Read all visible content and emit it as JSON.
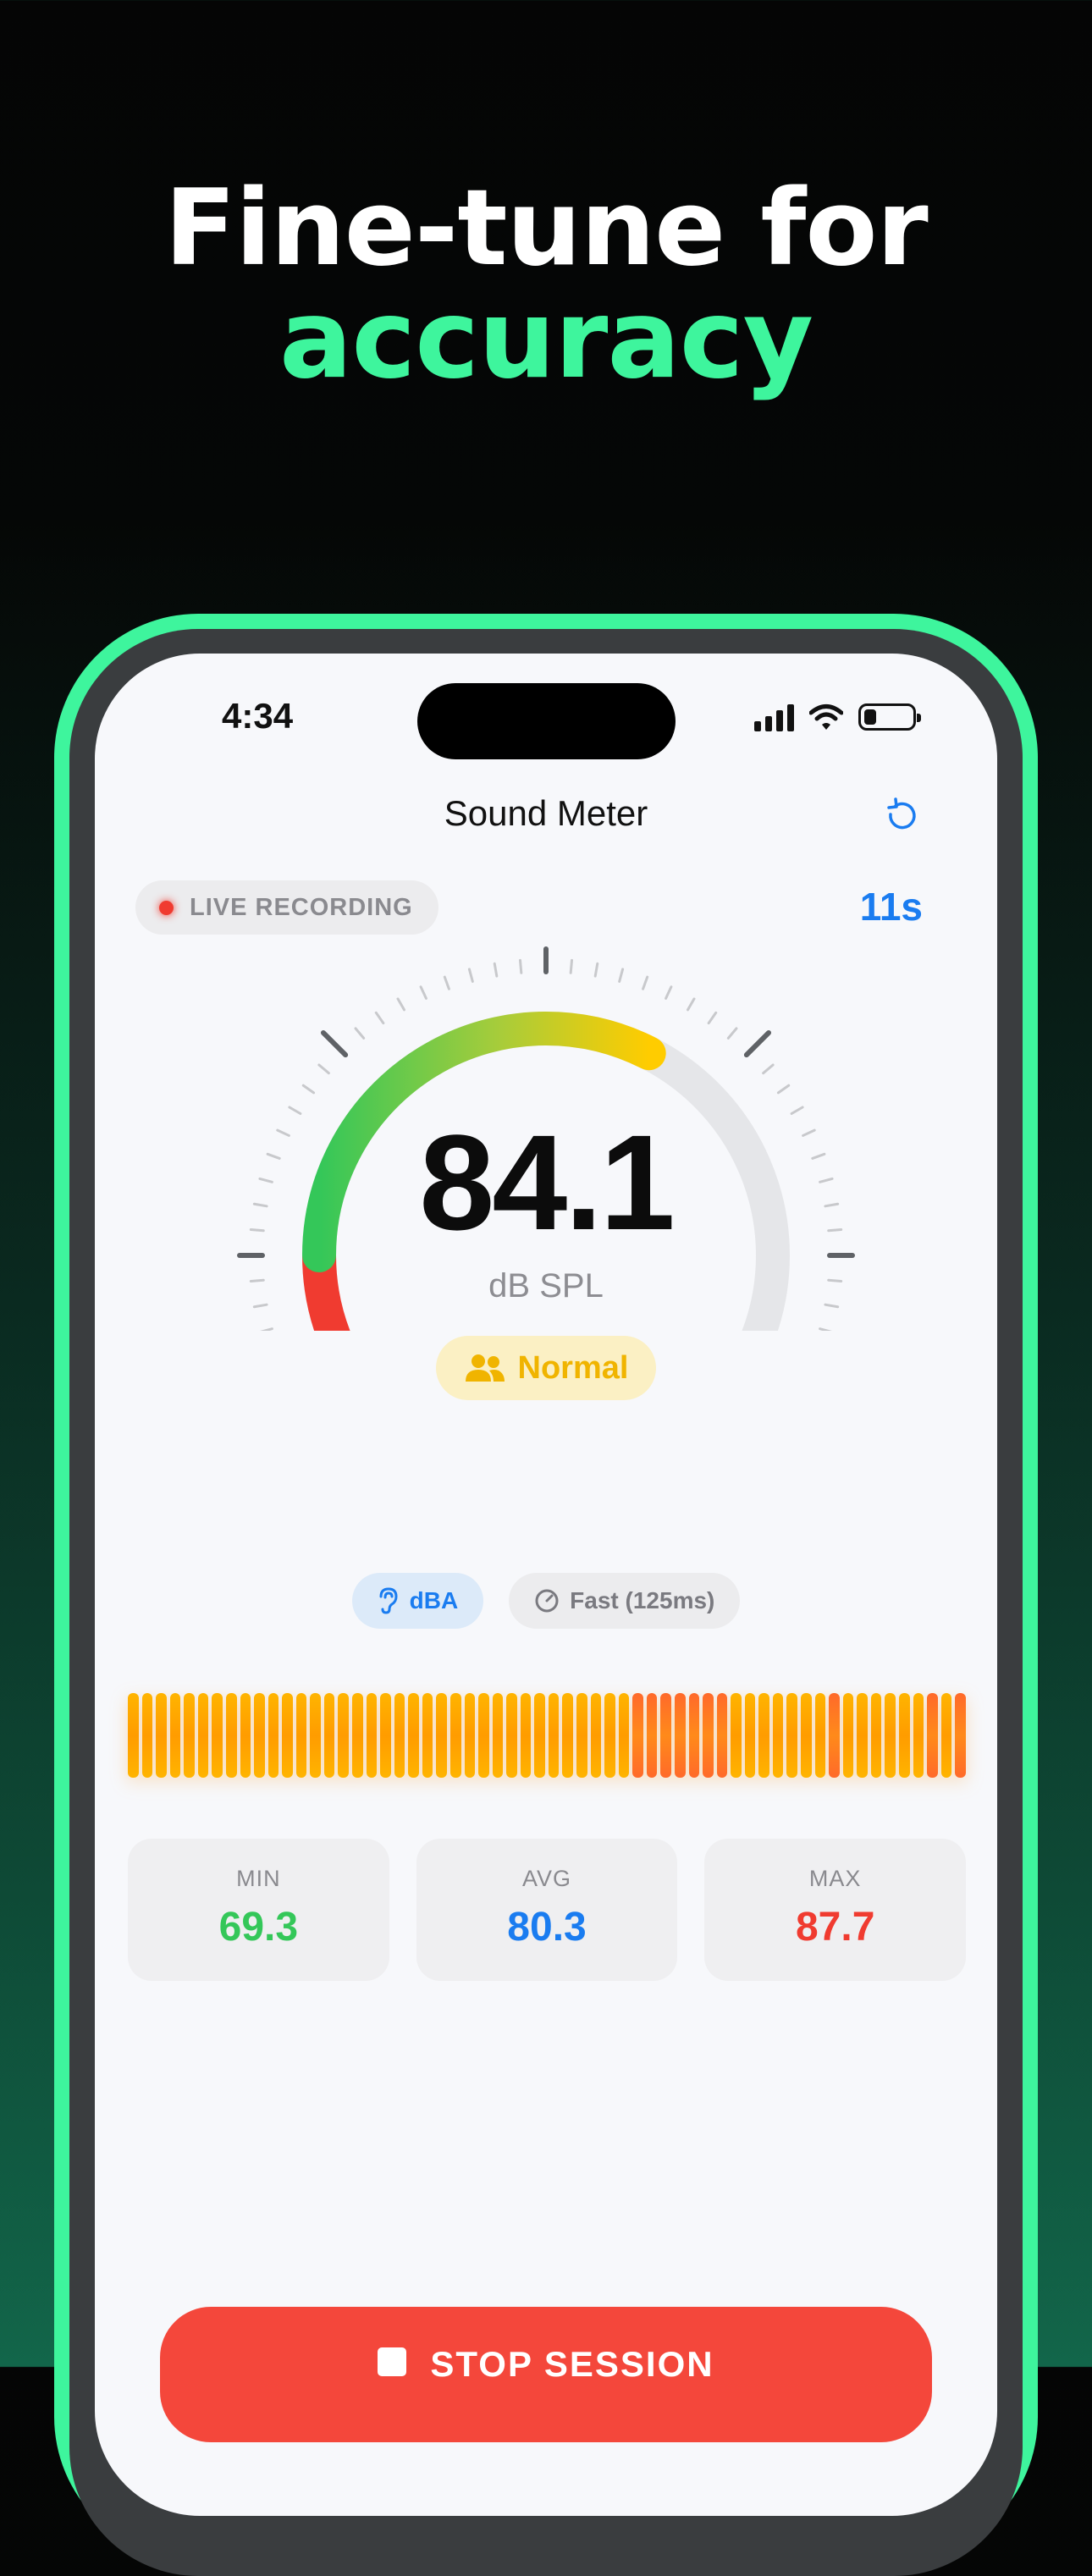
{
  "headline": {
    "line1": "Fine-tune for",
    "line2": "accuracy"
  },
  "status_bar": {
    "time": "4:34"
  },
  "nav": {
    "title": "Sound Meter",
    "reset_icon": "reset-icon"
  },
  "recording": {
    "badge": "LIVE RECORDING",
    "elapsed": "11s"
  },
  "meter": {
    "value": "84.1",
    "unit": "dB SPL",
    "level_label": "Normal",
    "level_icon": "people-icon",
    "gauge_fill_fraction": 0.6,
    "colors": {
      "red": "#f03b30",
      "green": "#34c759",
      "yellow": "#ffcc00",
      "track": "#e5e6e9"
    }
  },
  "chips": {
    "weighting": "dBA",
    "response": "Fast (125ms)"
  },
  "stats": [
    {
      "label": "MIN",
      "value": "69.3",
      "color": "#34c759"
    },
    {
      "label": "AVG",
      "value": "80.3",
      "color": "#1a7cf0"
    },
    {
      "label": "MAX",
      "value": "87.7",
      "color": "#f03b30"
    }
  ],
  "stop_button": {
    "label": "STOP SESSION"
  },
  "accent": "#3ef59d"
}
